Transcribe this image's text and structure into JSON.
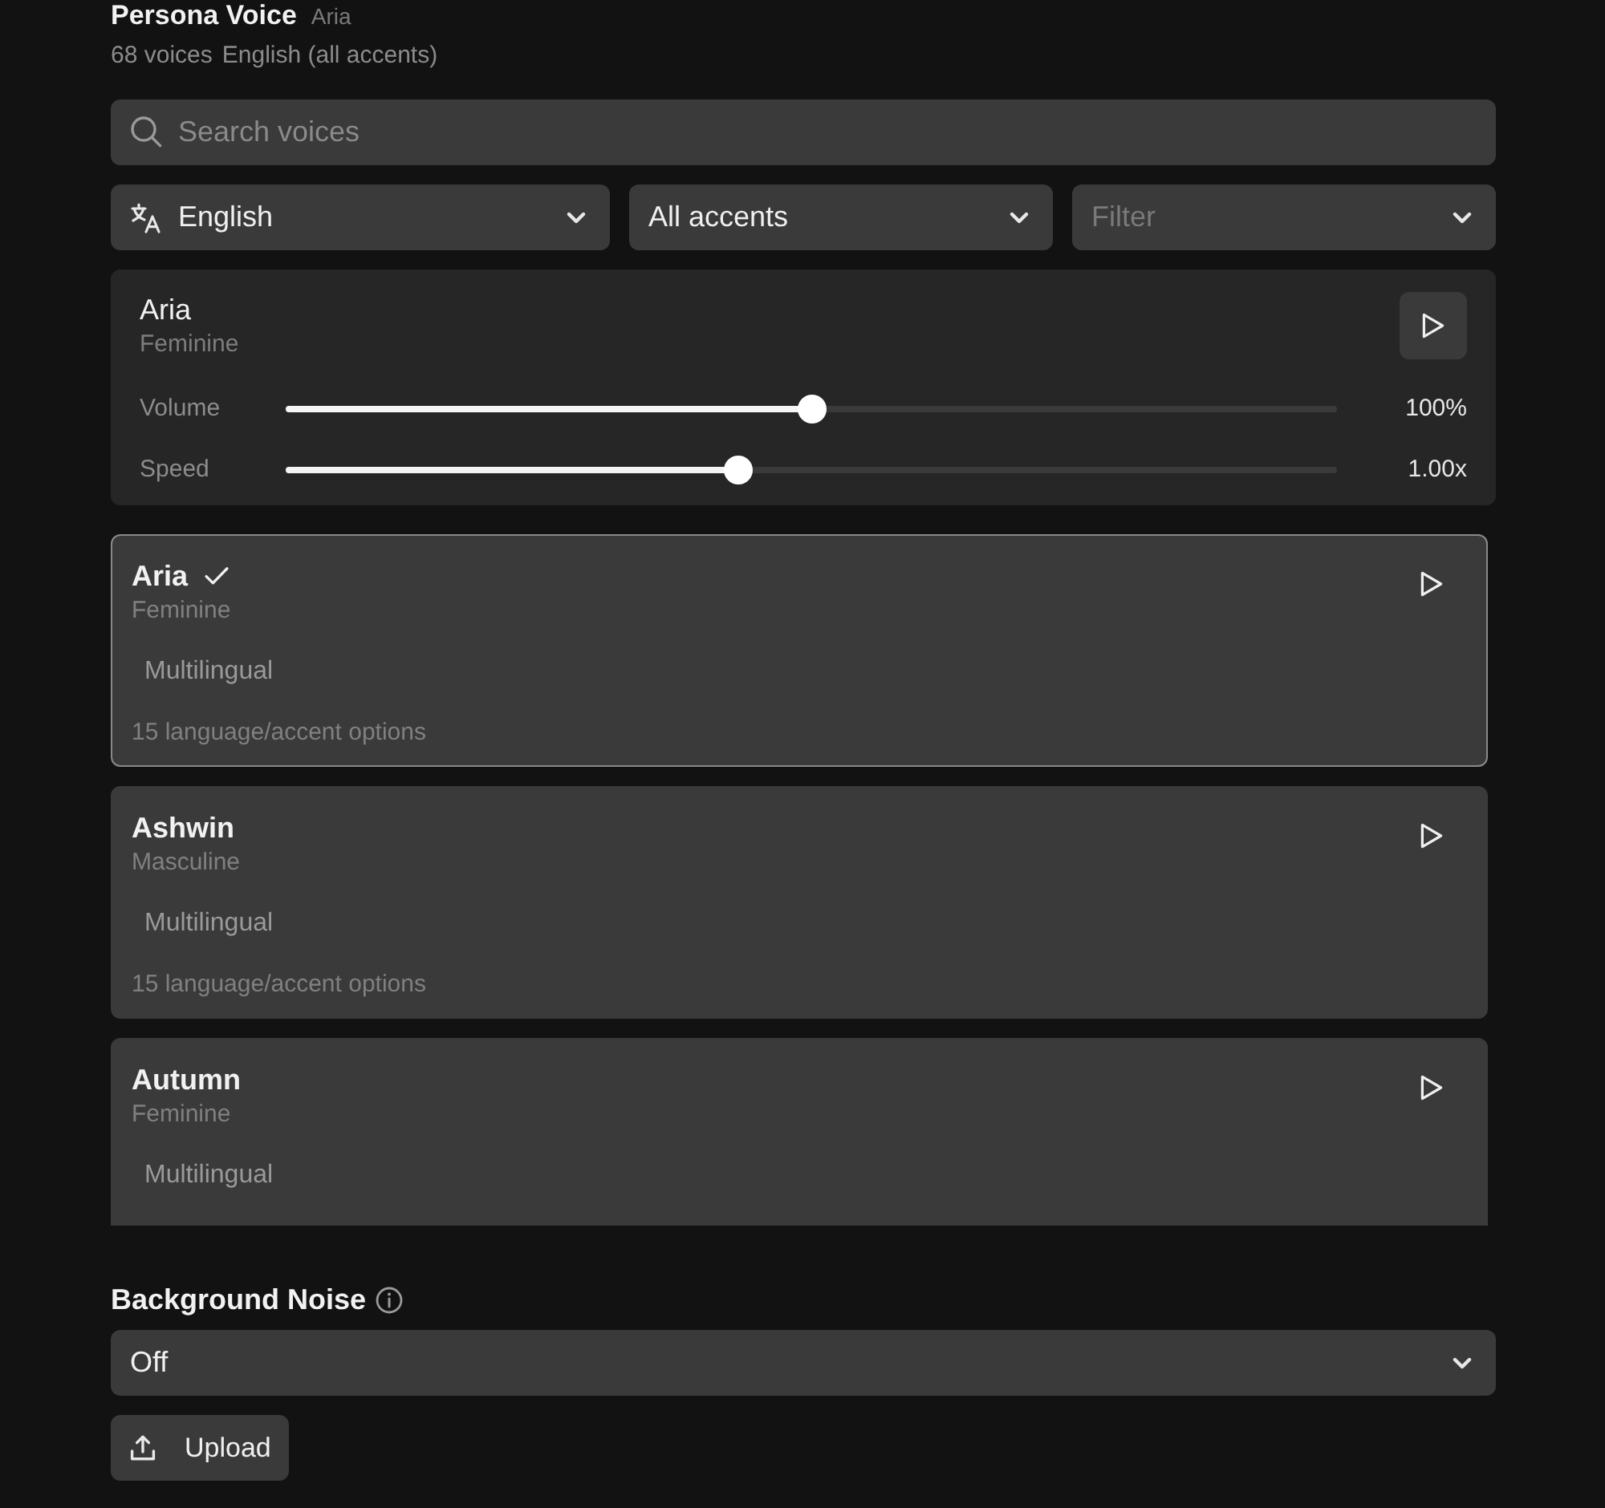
{
  "header": {
    "title": "Persona Voice",
    "selected_voice": "Aria",
    "voice_count": "68 voices",
    "language_summary": "English (all accents)"
  },
  "search": {
    "placeholder": "Search voices"
  },
  "filters": [
    {
      "kind": "language",
      "value": "English"
    },
    {
      "kind": "select",
      "value": "All accents"
    },
    {
      "kind": "select",
      "placeholder": "Filter"
    }
  ],
  "preview": {
    "name": "Aria",
    "gender": "Feminine",
    "sliders": [
      {
        "label": "Volume",
        "level": 0.5,
        "reading": "100%"
      },
      {
        "label": "Speed",
        "level": 0.43,
        "reading": "1.00x"
      }
    ]
  },
  "voices": [
    {
      "name": "Aria",
      "gender": "Feminine",
      "tag": "Multilingual",
      "options": "15 language/accent options",
      "selected": true
    },
    {
      "name": "Ashwin",
      "gender": "Masculine",
      "tag": "Multilingual",
      "options": "15 language/accent options",
      "selected": false
    },
    {
      "name": "Autumn",
      "gender": "Feminine",
      "tag": "Multilingual",
      "selected": false
    }
  ],
  "background_noise": {
    "label": "Background Noise",
    "value": "Off"
  },
  "upload_button": {
    "label": "Upload"
  }
}
